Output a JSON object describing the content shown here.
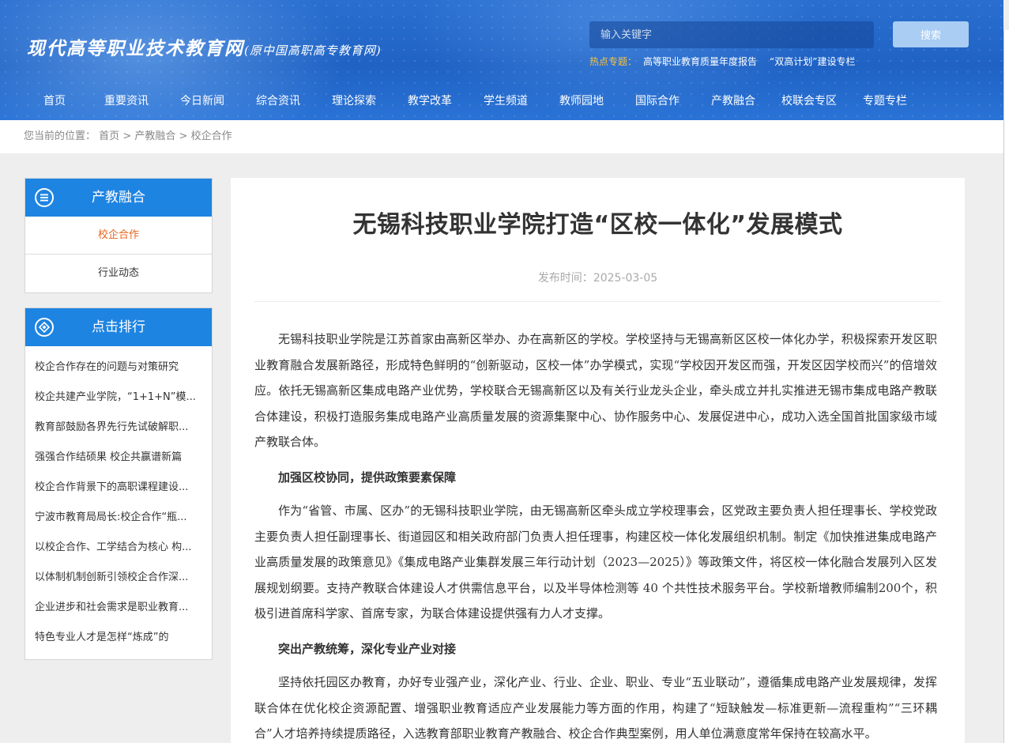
{
  "site": {
    "logo": "现代高等职业技术教育网",
    "logo_sub": "(原中国高职高专教育网)",
    "search_placeholder": "输入关键字",
    "search_button": "搜索",
    "hot_label": "热点专题：",
    "hot_links": [
      "高等职业教育质量年度报告",
      "“双高计划”建设专栏"
    ]
  },
  "nav": [
    "首页",
    "重要资讯",
    "今日新闻",
    "综合资讯",
    "理论探索",
    "教学改革",
    "学生频道",
    "教师园地",
    "国际合作",
    "产教融合",
    "校联会专区",
    "专题专栏"
  ],
  "breadcrumb": {
    "prefix": "您当前的位置：",
    "items": [
      "首页",
      "产教融合",
      "校企合作"
    ],
    "sep": ">"
  },
  "sidebar": {
    "category": {
      "title": "产教融合",
      "icon": "list-circle-icon",
      "items": [
        "校企合作",
        "行业动态"
      ],
      "active_index": 0
    },
    "ranking": {
      "title": "点击排行",
      "icon": "diamond-circle-icon",
      "items": [
        "校企合作存在的问题与对策研究",
        "校企共建产业学院，“1+1+N”模...",
        "教育部鼓励各界先行先试破解职...",
        "强强合作结硕果 校企共赢谱新篇",
        "校企合作背景下的高职课程建设...",
        "宁波市教育局局长:校企合作“瓶...",
        "以校企合作、工学结合为核心 构...",
        "以体制机制创新引领校企合作深...",
        "企业进步和社会需求是职业教育...",
        "特色专业人才是怎样“炼成”的"
      ]
    }
  },
  "article": {
    "title": "无锡科技职业学院打造“区校一体化”发展模式",
    "meta_label": "发布时间：",
    "date": "2025-03-05",
    "paragraphs": [
      "无锡科技职业学院是江苏首家由高新区举办、办在高新区的学校。学校坚持与无锡高新区区校一体化办学，积极探索开发区职业教育融合发展新路径，形成特色鲜明的“创新驱动，区校一体”办学模式，实现“学校因开发区而强，开发区因学校而兴”的倍增效应。依托无锡高新区集成电路产业优势，学校联合无锡高新区以及有关行业龙头企业，牵头成立并扎实推进无锡市集成电路产教联合体建设，积极打造服务集成电路产业高质量发展的资源集聚中心、协作服务中心、发展促进中心，成功入选全国首批国家级市域产教联合体。",
      "加强区校协同，提供政策要素保障",
      "作为“省管、市属、区办”的无锡科技职业学院，由无锡高新区牵头成立学校理事会，区党政主要负责人担任理事长、学校党政主要负责人担任副理事长、街道园区和相关政府部门负责人担任理事，构建区校一体化发展组织机制。制定《加快推进集成电路产业高质量发展的政策意见》《集成电路产业集群发展三年行动计划（2023—2025）》等政策文件，将区校一体化融合发展列入区发展规划纲要。支持产教联合体建设人才供需信息平台，以及半导体检测等 40 个共性技术服务平台。学校新增教师编制200个，积极引进首席科学家、首席专家，为联合体建设提供强有力人才支撑。",
      "突出产教统筹，深化专业产业对接",
      "坚持依托园区办教育，办好专业强产业，深化产业、行业、企业、职业、专业“五业联动”，遵循集成电路产业发展规律，发挥联合体在优化校企资源配置、增强职业教育适应产业发展能力等方面的作用，构建了“短缺触发—标准更新—流程重构”“三环耦合”人才培养持续提质路径，入选教育部职业教育产教融合、校企合作典型案例，用人单位满意度常年保持在较高水平。"
    ],
    "heading_indexes": [
      1,
      3
    ]
  }
}
